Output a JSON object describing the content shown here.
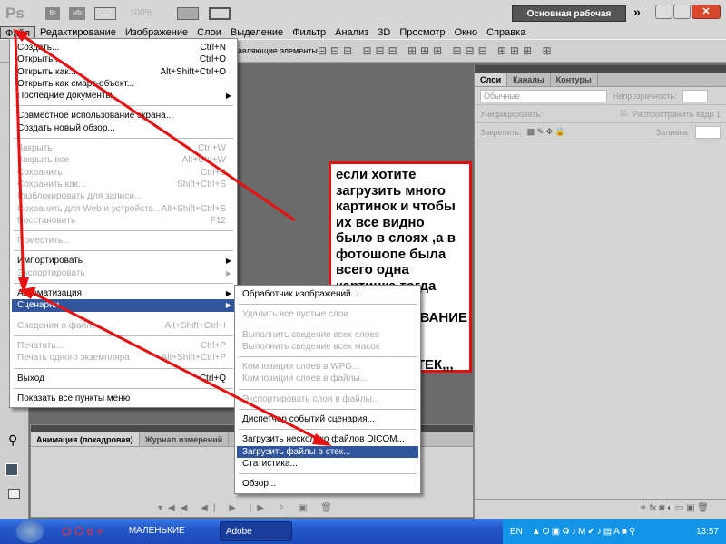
{
  "app": {
    "logo": "Ps",
    "buttons": [
      "Br",
      "Mb"
    ],
    "zoom": "100%",
    "workspace": "Основная рабочая среда"
  },
  "menubar": [
    "Файл",
    "Редактирование",
    "Изображение",
    "Слои",
    "Выделение",
    "Фильтр",
    "Анализ",
    "3D",
    "Просмотр",
    "Окно",
    "Справка"
  ],
  "optbar": {
    "text": "авляющие элементы"
  },
  "file_menu": [
    {
      "label": "Создать...",
      "shortcut": "Ctrl+N"
    },
    {
      "label": "Открыть...",
      "shortcut": "Ctrl+O"
    },
    {
      "label": "Открыть как...",
      "shortcut": "Alt+Shift+Ctrl+O"
    },
    {
      "label": "Открыть как смарт-объект...",
      "shortcut": ""
    },
    {
      "label": "Последние документы",
      "shortcut": "",
      "sub": true
    },
    {
      "sep": true
    },
    {
      "label": "Совместное использование экрана...",
      "shortcut": ""
    },
    {
      "label": "Создать новый обзор...",
      "shortcut": ""
    },
    {
      "sep": true
    },
    {
      "label": "Закрыть",
      "shortcut": "Ctrl+W",
      "dis": true
    },
    {
      "label": "Закрыть все",
      "shortcut": "Alt+Ctrl+W",
      "dis": true
    },
    {
      "label": "Сохранить",
      "shortcut": "Ctrl+S",
      "dis": true
    },
    {
      "label": "Сохранить как...",
      "shortcut": "Shift+Ctrl+S",
      "dis": true
    },
    {
      "label": "Разблокировать для записи...",
      "shortcut": "",
      "dis": true
    },
    {
      "label": "Сохранить для Web и устройств...",
      "shortcut": "Alt+Shift+Ctrl+S",
      "dis": true
    },
    {
      "label": "Восстановить",
      "shortcut": "F12",
      "dis": true
    },
    {
      "sep": true
    },
    {
      "label": "Поместить...",
      "shortcut": "",
      "dis": true
    },
    {
      "sep": true
    },
    {
      "label": "Импортировать",
      "shortcut": "",
      "sub": true
    },
    {
      "label": "Экспортировать",
      "shortcut": "",
      "sub": true,
      "dis": true
    },
    {
      "sep": true
    },
    {
      "label": "Автоматизация",
      "shortcut": "",
      "sub": true
    },
    {
      "label": "Сценарии",
      "shortcut": "",
      "sub": true,
      "hl": true
    },
    {
      "sep": true
    },
    {
      "label": "Сведения о файле...",
      "shortcut": "Alt+Shift+Ctrl+I",
      "dis": true
    },
    {
      "sep": true
    },
    {
      "label": "Печатать...",
      "shortcut": "Ctrl+P",
      "dis": true
    },
    {
      "label": "Печать одного экземпляра",
      "shortcut": "Alt+Shift+Ctrl+P",
      "dis": true
    },
    {
      "sep": true
    },
    {
      "label": "Выход",
      "shortcut": "Ctrl+Q"
    },
    {
      "sep": true
    },
    {
      "label": "Показать все пункты меню",
      "shortcut": ""
    }
  ],
  "scripts_menu": [
    {
      "label": "Обработчик изображений..."
    },
    {
      "sep": true
    },
    {
      "label": "Удалить все пустые слои",
      "dis": true
    },
    {
      "sep": true
    },
    {
      "label": "Выполнить сведение всех слоев",
      "dis": true
    },
    {
      "label": "Выполнить сведение всех масок",
      "dis": true
    },
    {
      "sep": true
    },
    {
      "label": "Композиции слоев в WPG...",
      "dis": true
    },
    {
      "label": "Композиции слоев в файлы...",
      "dis": true
    },
    {
      "sep": true
    },
    {
      "label": "Экспортировать слои в файлы...",
      "dis": true
    },
    {
      "sep": true
    },
    {
      "label": "Диспетчер событий сценария..."
    },
    {
      "sep": true
    },
    {
      "label": "Загрузить несколько файлов DICOM..."
    },
    {
      "label": "Загрузить файлы в стек...",
      "hl": true
    },
    {
      "label": "Статистика..."
    },
    {
      "sep": true
    },
    {
      "label": "Обзор..."
    }
  ],
  "layers_panel": {
    "tabs": [
      "Слои",
      "Каналы",
      "Контуры"
    ],
    "blend": "Обычные",
    "opacity_label": "Непрозрачность:",
    "unify_label": "Унифицировать:",
    "propagate_label": "Распространить кадр 1",
    "lock_label": "Закрепить:",
    "fill_label": "Заливка:"
  },
  "anim_panel": {
    "tabs": [
      "Анимация (покадровая)",
      "Журнал измерений"
    ]
  },
  "note": "если хотите загрузить много картинок и чтобы их все видно было в слоях ,а в фотошопе была всего одна картинка,тогда идите  в РЕДАКТИРОВАНИЕ -СЦЕНАРИИ -ЗАГРУЗИТЬ ФАЙЛЫ В СТЕК,,,",
  "taskbar": {
    "items": [
      "МАЛЕНЬКИЕ ХИТРОС...",
      "Adobe Photoshop CS..."
    ],
    "lang": "EN",
    "time": "13:57"
  },
  "colors": {
    "highlight": "#31569d",
    "annotation": "#e01010"
  }
}
